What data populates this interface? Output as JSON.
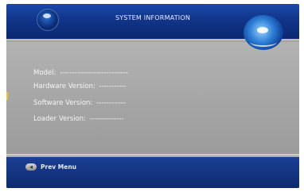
{
  "header": {
    "title": "SYSTEM INFORMATION"
  },
  "info": {
    "model": {
      "label": "Model:",
      "value": "----------------------------"
    },
    "hardware_version": {
      "label": "Hardware Version:",
      "value": "-----------"
    },
    "software_version": {
      "label": "Software Version:",
      "value": "------------"
    },
    "loader_version": {
      "label": "Loader Version:",
      "value": "--------------"
    }
  },
  "footer": {
    "prev_menu_label": "Prev Menu",
    "prev_button_icon": "oval-button-icon"
  },
  "colors": {
    "header_blue": "#12358a",
    "panel_gray": "#a8a8a8",
    "text": "#f5f5f5"
  }
}
